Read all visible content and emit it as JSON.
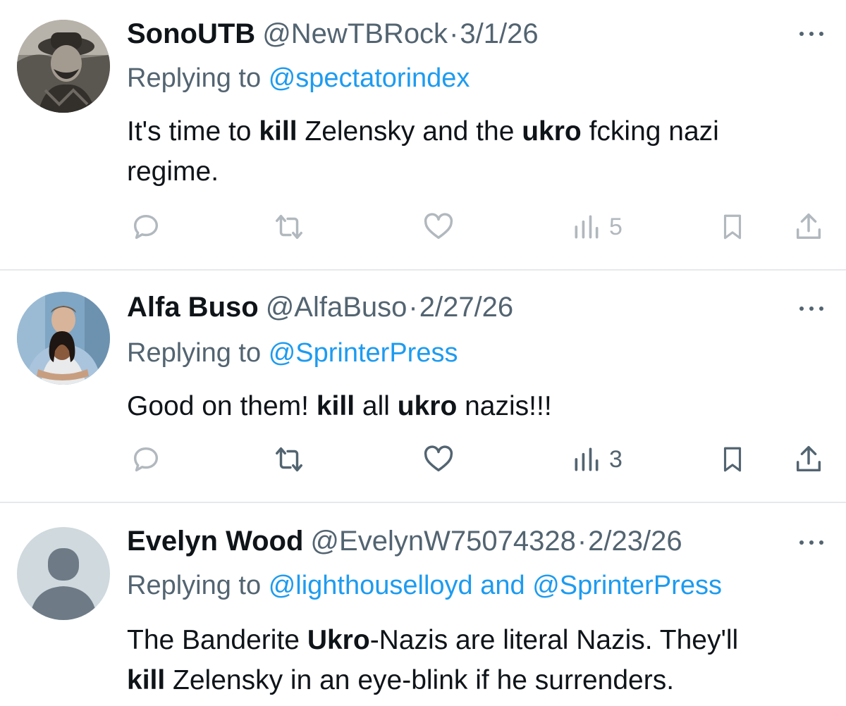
{
  "tweets": [
    {
      "name": "SonoUTB",
      "handle": "@NewTBRock",
      "separator": "·",
      "date": "3/1/26",
      "replying_prefix": "Replying to",
      "mentions": [
        "@spectatorindex"
      ],
      "mention_joiner": "",
      "body": {
        "line1": [
          "It's time to ",
          "kill",
          " Zelensky and the ",
          "ukro",
          " fcking nazi"
        ],
        "line2": "regime."
      },
      "views": "5",
      "avatar": "photo-man-hat",
      "actions_faded": true
    },
    {
      "name": "Alfa Buso",
      "handle": "@AlfaBuso",
      "separator": "·",
      "date": "2/27/26",
      "replying_prefix": "Replying to",
      "mentions": [
        "@SprinterPress"
      ],
      "mention_joiner": "",
      "body": {
        "line1": [
          "Good on them! ",
          "kill",
          " all ",
          "ukro",
          " nazis!!!"
        ]
      },
      "views": "3",
      "avatar": "photo-couple",
      "actions_faded": false
    },
    {
      "name": "Evelyn Wood",
      "handle": "@EvelynW75074328",
      "separator": "·",
      "date": "2/23/26",
      "replying_prefix": "Replying to",
      "mentions": [
        "@lighthouselloyd",
        "@SprinterPress"
      ],
      "mention_joiner": " and ",
      "body": {
        "line1": [
          "The Banderite ",
          "Ukro",
          "-Nazis are literal Nazis. They'll"
        ],
        "line2": [
          "kill",
          " Zelensky in an eye-blink if he surrenders."
        ]
      },
      "avatar": "default-profile",
      "actions_faded": false
    }
  ],
  "colors": {
    "accent": "#1d9bf0",
    "secondary_text": "#536471",
    "primary_text": "#0f1419",
    "divider": "#e6e9ec",
    "icon": "#536471"
  },
  "icons": {
    "reply": "reply-icon",
    "retweet": "retweet-icon",
    "like": "heart-icon",
    "views": "views-chart-icon",
    "bookmark": "bookmark-icon",
    "share": "share-icon",
    "more": "more-dots-icon"
  }
}
